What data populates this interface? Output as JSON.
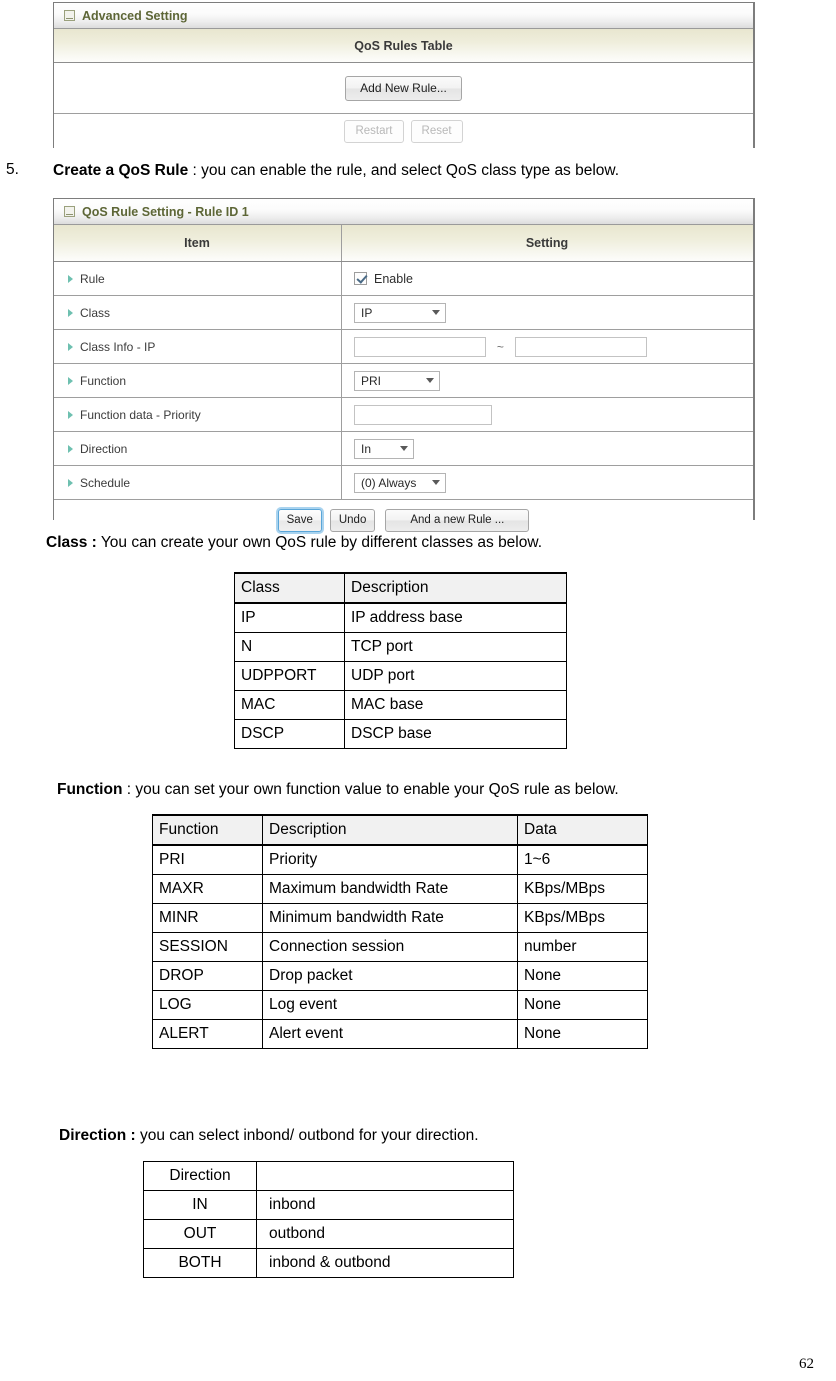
{
  "panel_qos_rules_table": {
    "title": "Advanced Setting",
    "band_label": "QoS Rules Table",
    "add_button": "Add New Rule...",
    "restart_button": "Restart",
    "reset_button": "Reset"
  },
  "step5": {
    "number": "5.",
    "bold": "Create a QoS Rule",
    "rest": " : you can enable the rule, and select QoS class type as below."
  },
  "panel_rule_setting": {
    "title": "QoS Rule Setting - Rule ID 1",
    "col_item": "Item",
    "col_setting": "Setting",
    "rows": [
      {
        "item": "Rule",
        "control": "checkbox",
        "value": "Enable"
      },
      {
        "item": "Class",
        "control": "select",
        "value": "IP"
      },
      {
        "item": "Class Info - IP",
        "control": "range",
        "value": "",
        "value2": "",
        "separator": "~"
      },
      {
        "item": "Function",
        "control": "select",
        "value": "PRI"
      },
      {
        "item": "Function data - Priority",
        "control": "text",
        "value": ""
      },
      {
        "item": "Direction",
        "control": "select",
        "value": "In"
      },
      {
        "item": "Schedule",
        "control": "select",
        "value": "(0) Always"
      }
    ],
    "save_button": "Save",
    "undo_button": "Undo",
    "new_rule_button": "And a new Rule ..."
  },
  "class_section": {
    "bold": "Class :",
    "rest": " You can create your own QoS rule by different classes as below.",
    "table": {
      "headers": [
        "Class",
        "Description"
      ],
      "rows": [
        [
          "IP",
          "IP address base"
        ],
        [
          "N",
          "TCP port"
        ],
        [
          "UDPPORT",
          "UDP port"
        ],
        [
          "MAC",
          "MAC base"
        ],
        [
          "DSCP",
          "DSCP base"
        ]
      ]
    }
  },
  "function_section": {
    "bold": "Function",
    "rest": " : you can set your own function value to enable your QoS rule as below.",
    "table": {
      "headers": [
        "Function",
        "Description",
        "Data"
      ],
      "rows": [
        [
          "PRI",
          "Priority",
          "1~6"
        ],
        [
          "MAXR",
          "Maximum bandwidth Rate",
          "KBps/MBps"
        ],
        [
          "MINR",
          "Minimum bandwidth Rate",
          "KBps/MBps"
        ],
        [
          "SESSION",
          "Connection session",
          "number"
        ],
        [
          "DROP",
          "Drop packet",
          "None"
        ],
        [
          "LOG",
          "Log event",
          "None"
        ],
        [
          "ALERT",
          "Alert event",
          "None"
        ]
      ]
    }
  },
  "direction_section": {
    "bold": "Direction :",
    "rest": " you can select inbond/ outbond for your direction.",
    "table": {
      "headers": [
        "Direction",
        ""
      ],
      "rows": [
        [
          "IN",
          "inbond"
        ],
        [
          "OUT",
          "outbond"
        ],
        [
          "BOTH",
          "inbond & outbond"
        ]
      ]
    }
  },
  "page": {
    "number": "62"
  }
}
